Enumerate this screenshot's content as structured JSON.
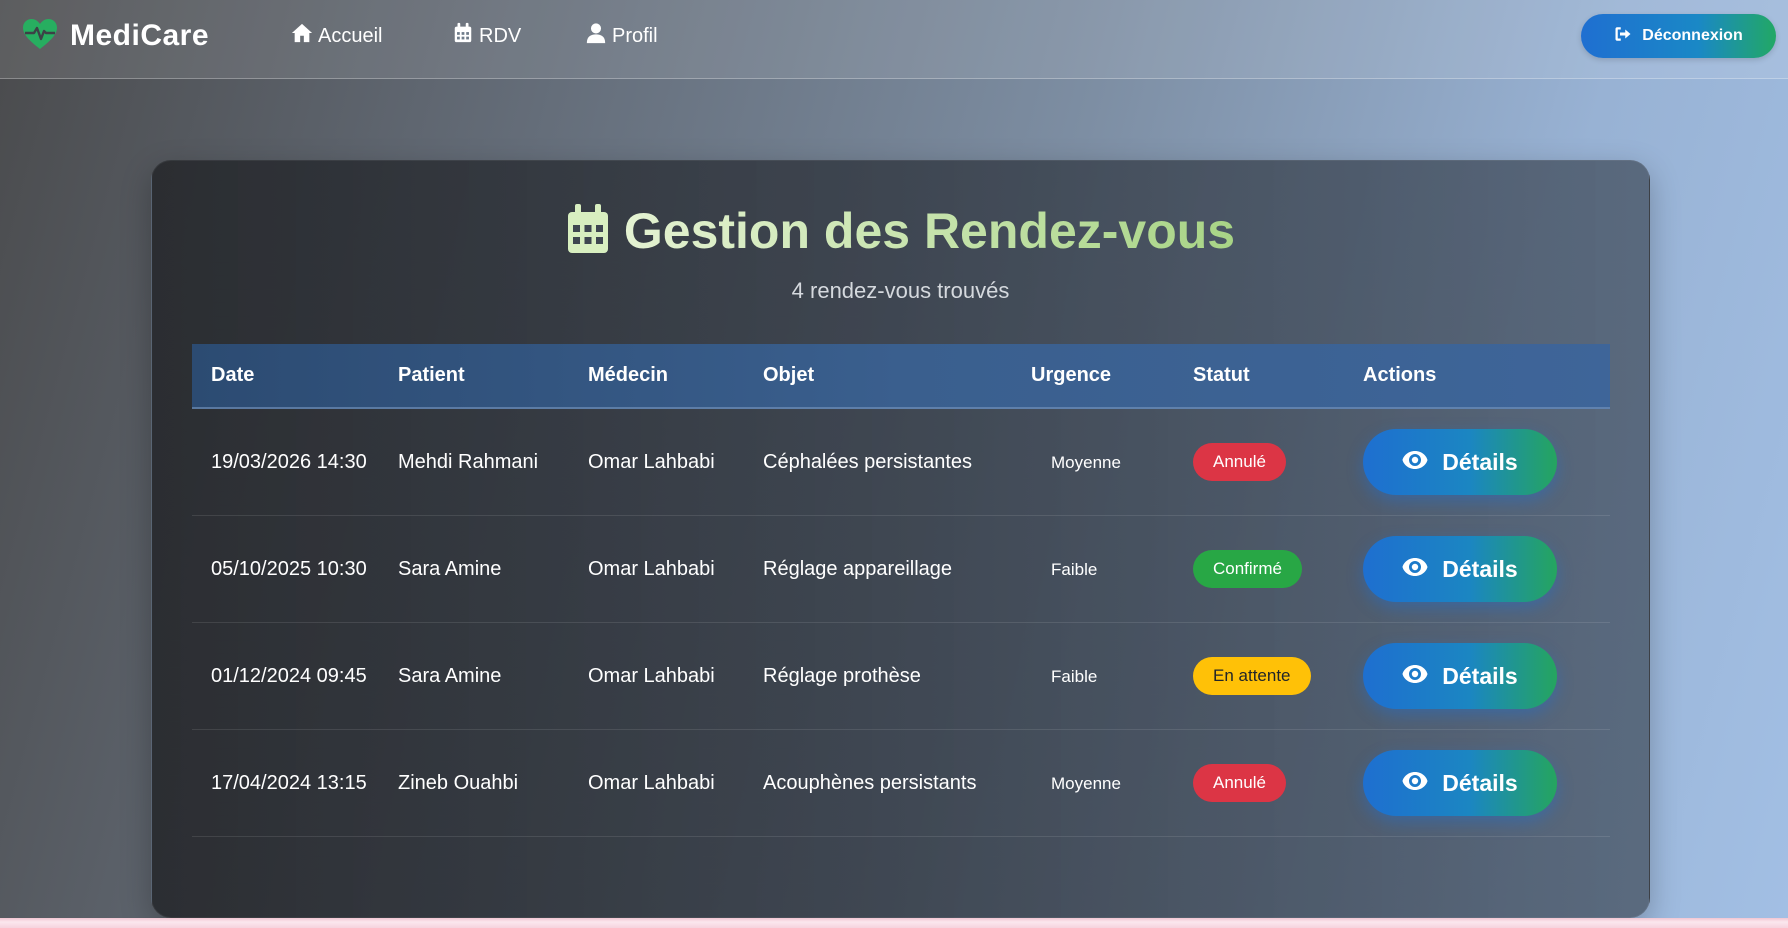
{
  "brand": {
    "name": "MediCare",
    "icon": "heartbeat-icon",
    "color": "#27ae60"
  },
  "nav": [
    {
      "label": "Accueil",
      "icon": "home-icon"
    },
    {
      "label": "RDV",
      "icon": "calendar-icon"
    },
    {
      "label": "Profil",
      "icon": "user-icon"
    }
  ],
  "logout": {
    "label": "Déconnexion",
    "icon": "sign-out-icon"
  },
  "main": {
    "title": "Gestion des Rendez-vous",
    "title_icon": "calendar-icon",
    "subtitle": "4 rendez-vous trouvés"
  },
  "table": {
    "headers": [
      "Date",
      "Patient",
      "Médecin",
      "Objet",
      "Urgence",
      "Statut",
      "Actions"
    ],
    "rows": [
      {
        "date": "19/03/2026 14:30",
        "patient": "Mehdi Rahmani",
        "medecin": "Omar Lahbabi",
        "objet": "Céphalées persistantes",
        "urgence": "Moyenne",
        "statut": "Annulé",
        "action": "Détails"
      },
      {
        "date": "05/10/2025 10:30",
        "patient": "Sara Amine",
        "medecin": "Omar Lahbabi",
        "objet": "Réglage appareillage",
        "urgence": "Faible",
        "statut": "Confirmé",
        "action": "Détails"
      },
      {
        "date": "01/12/2024 09:45",
        "patient": "Sara Amine",
        "medecin": "Omar Lahbabi",
        "objet": "Réglage prothèse",
        "urgence": "Faible",
        "statut": "En attente",
        "action": "Détails"
      },
      {
        "date": "17/04/2024 13:15",
        "patient": "Zineb Ouahbi",
        "medecin": "Omar Lahbabi",
        "objet": "Acouphènes persistants",
        "urgence": "Moyenne",
        "statut": "Annulé",
        "action": "Détails"
      }
    ]
  },
  "status_colors": {
    "Annulé": "#dc3545",
    "Confirmé": "#28a745",
    "En attente": "#ffc107"
  },
  "accent": {
    "primary": "#1e6fd0",
    "secondary": "#25a55f",
    "title": "#bfe0a0"
  }
}
